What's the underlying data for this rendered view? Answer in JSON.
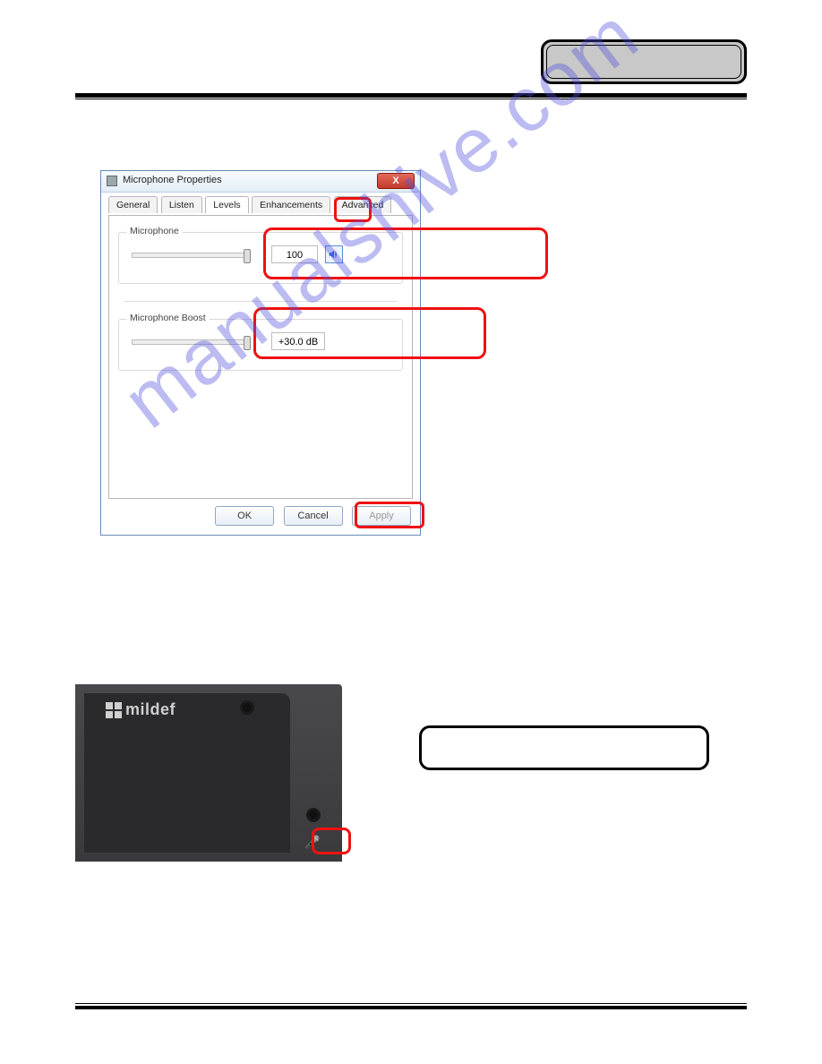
{
  "watermark": "manualshive.com",
  "dialog": {
    "title": "Microphone Properties",
    "close": "X",
    "tabs": {
      "general": "General",
      "listen": "Listen",
      "levels": "Levels",
      "enhancements": "Enhancements",
      "advanced": "Advanced"
    },
    "group_mic": {
      "label": "Microphone",
      "value": "100"
    },
    "group_boost": {
      "label": "Microphone Boost",
      "value": "+30.0 dB"
    },
    "buttons": {
      "ok": "OK",
      "cancel": "Cancel",
      "apply": "Apply"
    }
  },
  "photo": {
    "brand": "mildef",
    "mic_glyph": "🎤"
  }
}
